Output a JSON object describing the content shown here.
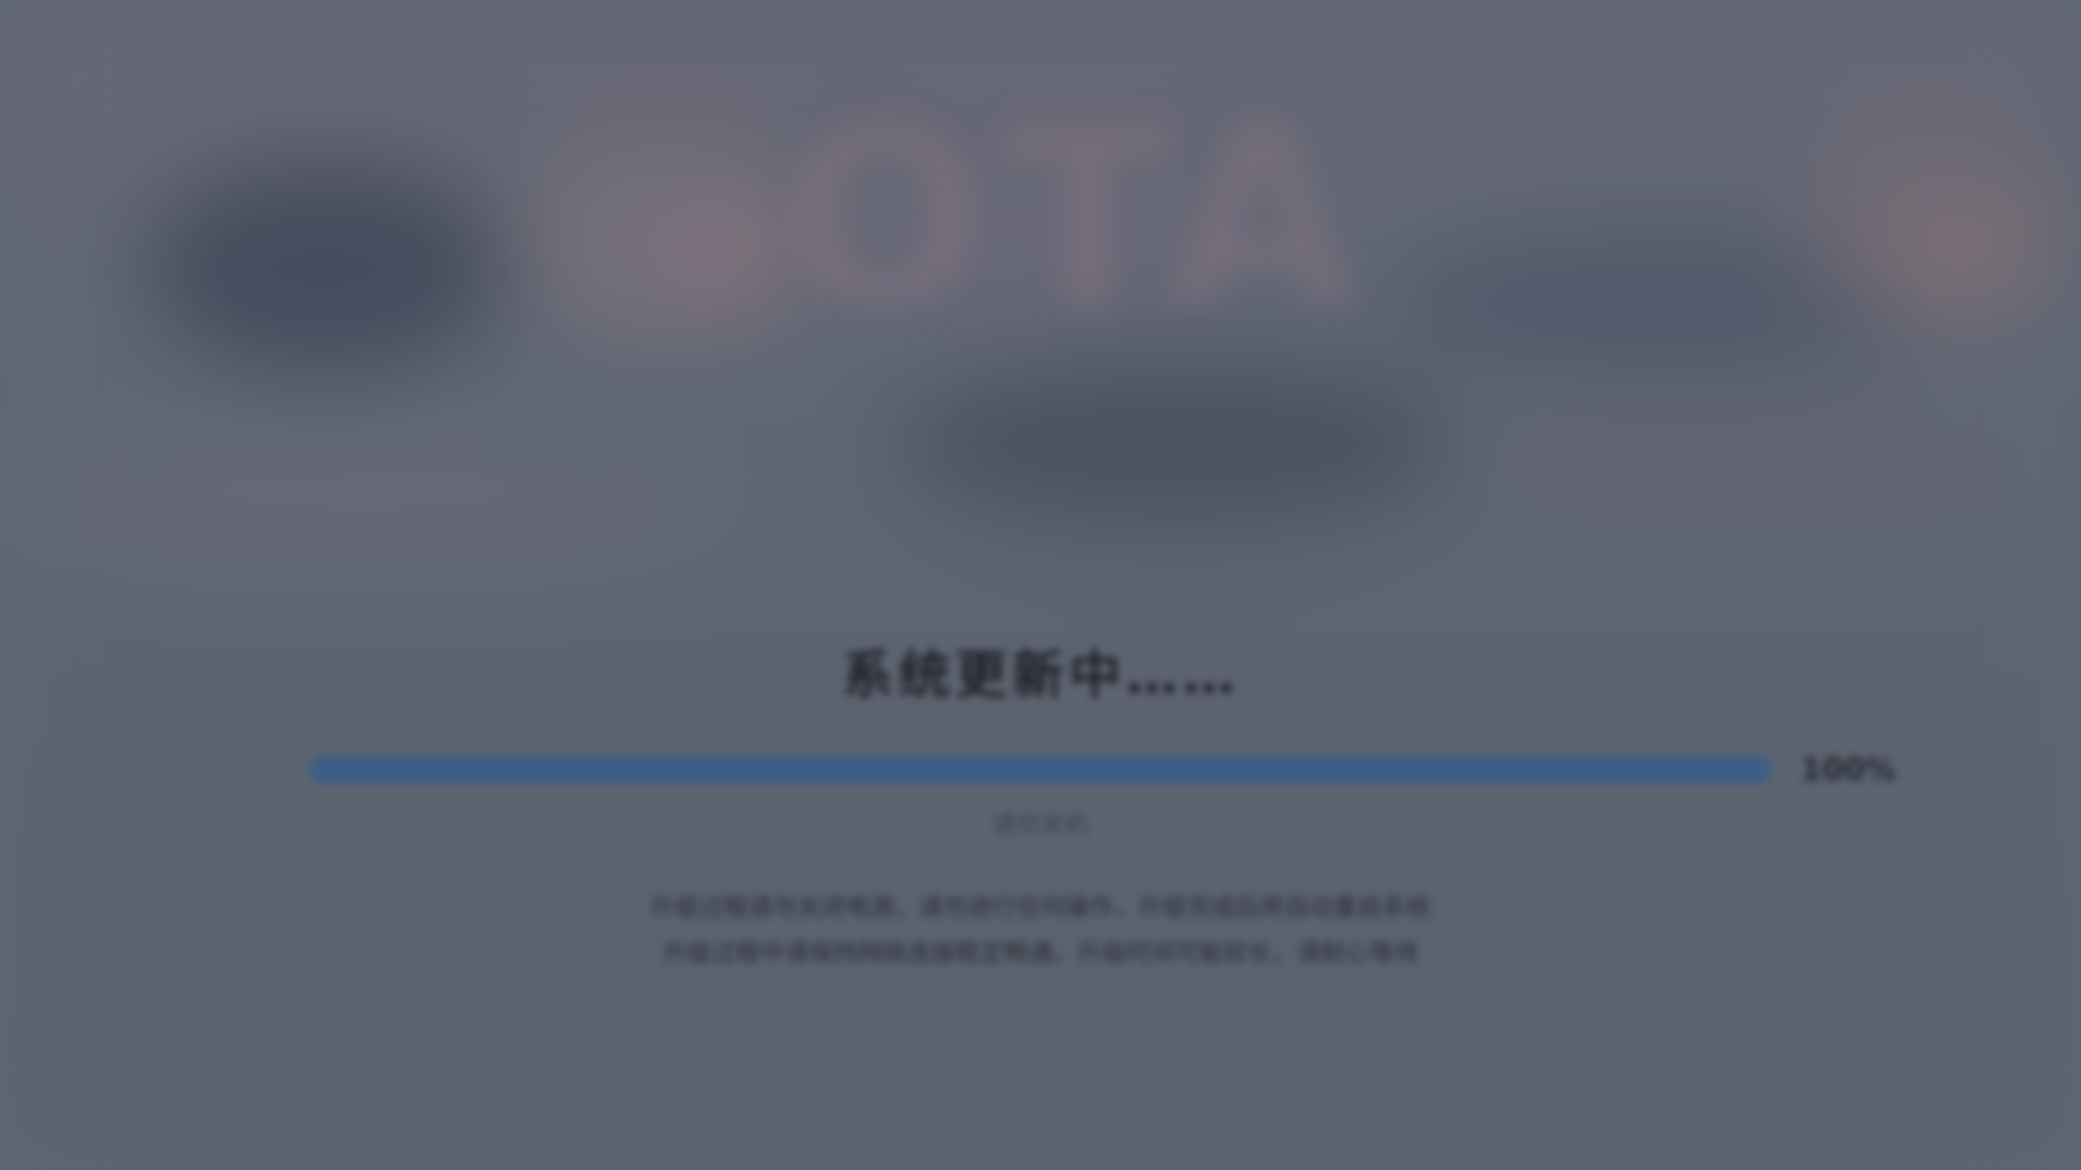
{
  "background": {
    "watermark_text": "OTA"
  },
  "update": {
    "title": "系统更新中……",
    "progress_percent": 100,
    "progress_label": "100%",
    "status_text": "请勿关机",
    "notice_lines": [
      "升级过程请勿关闭电源，请勿进行任何操作，升级完成后将自动重启系统",
      "升级过程中请保持网络连接稳定畅通，升级时间可能较长，请耐心等待"
    ]
  },
  "colors": {
    "progress_fill": "#3b5f86",
    "progress_track": "#4a5566",
    "background": "#636a77"
  }
}
